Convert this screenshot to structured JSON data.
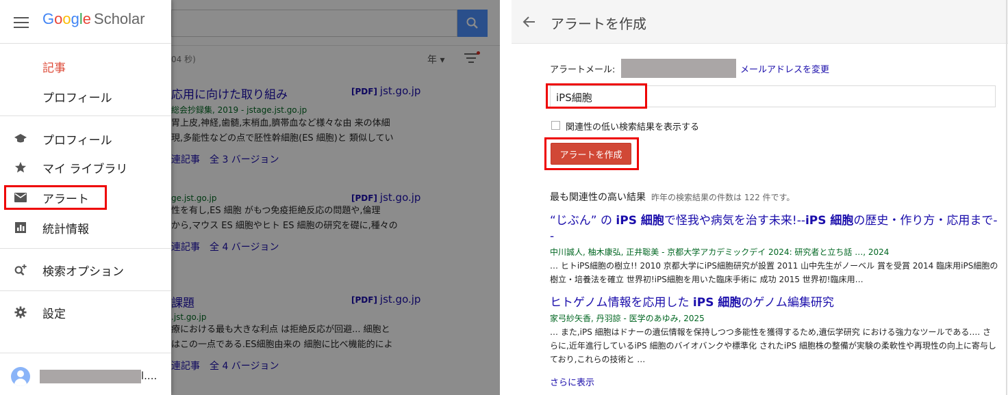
{
  "background": {
    "time_text": "04 秒)",
    "year_select": "年 ▾",
    "results": [
      {
        "title": "応用に向けた取り組み",
        "pdf_tag": "[PDF]",
        "pdf_domain": "jst.go.jp",
        "source": "総会抄録集, 2019 - jstage.jst.go.jp",
        "snippet1": "胃上皮,神経,歯髄,末梢血,臍帯血など様々な由 来の体細",
        "snippet2": "現,多能性などの点で胚性幹細胞(ES 細胞)と 類似してい",
        "related": "連記事",
        "versions": "全 3 バージョン"
      },
      {
        "title": "",
        "pdf_tag": "[PDF]",
        "pdf_domain": "jst.go.jp",
        "source": "ge.jst.go.jp",
        "snippet1": "性を有し,ES 細胞 がもつ免疫拒絶反応の問題や,倫理",
        "snippet2": "から,マウス ES 細胞やヒト ES 細胞の研究を礎に,種々の",
        "related": "連記事",
        "versions": "全 4 バージョン"
      },
      {
        "title": "課題",
        "pdf_tag": "[PDF]",
        "pdf_domain": "jst.go.jp",
        "source": ".jst.go.jp",
        "snippet1": "療における最も大きな利点 は拒絶反応が回避... 細胞と",
        "snippet2": "はこの一点である.ES細胞由来の 細胞に比べ機能的によ",
        "related": "連記事",
        "versions": "全 4 バージョン"
      }
    ]
  },
  "drawer": {
    "logo": {
      "g1": "G",
      "o1": "o",
      "o2": "o",
      "g2": "g",
      "l": "l",
      "e": "e",
      "scholar": "Scholar"
    },
    "items": [
      {
        "label": "記事",
        "icon": "none",
        "color": "#dd4b39"
      },
      {
        "label": "プロフィール",
        "icon": "none"
      },
      {
        "label": "プロフィール",
        "icon": "graduation-cap-icon"
      },
      {
        "label": "マイ ライブラリ",
        "icon": "star-icon"
      },
      {
        "label": "アラート",
        "icon": "mail-icon"
      },
      {
        "label": "統計情報",
        "icon": "stats-icon"
      },
      {
        "label": "検索オプション",
        "icon": "search-plus-icon"
      },
      {
        "label": "設定",
        "icon": "gear-icon"
      }
    ],
    "user_tail": "l...."
  },
  "alert": {
    "title": "アラートを作成",
    "email_label": "アラートメール:",
    "change_email": "メールアドレスを変更",
    "query": "iPS細胞",
    "checkbox_label": "関連性の低い検索結果を表示する",
    "create_button": "アラートを作成",
    "section_title": "最も関連性の高い結果",
    "section_sub": "昨年の検索結果の件数は 122 件です。",
    "results": [
      {
        "title_pre": "“じぶん” の ",
        "title_b1": "iPS 細胞",
        "title_mid": "で怪我や病気を治す未来!--",
        "title_b2": "iPS 細胞",
        "title_post": "の歴史・作り方・応用まで--",
        "source": "中川誠人,  柚木康弘,  正井聡美 - 京都大学アカデミックデイ 2024: 研究者と立ち話 …, 2024",
        "snippet": "… ヒトiPS細胞の樹立!! 2010 京都大学にiPS細胞研究が設置 2011 山中先生がノーベル 賞を受賞 2014 臨床用iPS細胞の樹立・培養法を確立 世界初!iPS細胞を用いた臨床手術に 成功 2015 世界初!臨床用…"
      },
      {
        "title_pre": "ヒトゲノム情報を応用した ",
        "title_b1": "iPS 細胞",
        "title_mid": "のゲノム編集研究",
        "title_b2": "",
        "title_post": "",
        "source": "家弓紗矢香,  丹羽諒 - 医学のあゆみ, 2025",
        "snippet": "… また,iPS 細胞はドナーの遺伝情報を保持しつつ多能性を獲得するため,遺伝学研究 における強力なツールである…. さらに,近年進行しているiPS 細胞のバイオバンクや標準化 されたiPS 細胞株の整備が実験の柔軟性や再現性の向上に寄与しており,これらの技術と …"
      }
    ],
    "more": "さらに表示"
  }
}
